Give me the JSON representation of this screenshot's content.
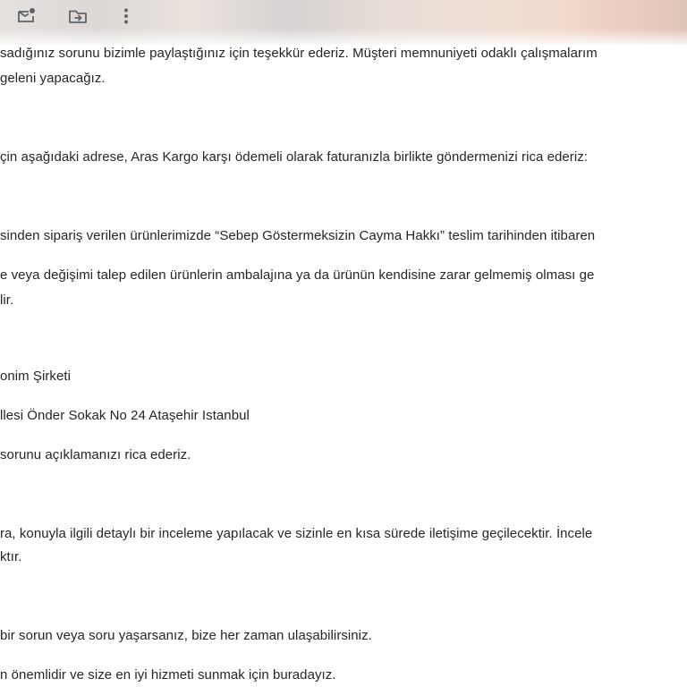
{
  "toolbar": {
    "icons": {
      "mark_unread": "mark-unread-icon",
      "move_to": "move-to-icon",
      "more": "more-vert-icon"
    }
  },
  "message": {
    "lines": [
      "sadığınız sorunu bizimle paylaştığınız için teşekkür ederiz. Müşteri memnuniyeti odaklı çalışmalarım",
      "geleni yapacağız.",
      "çin aşağıdaki adrese, Aras Kargo karşı ödemeli olarak faturanızla birlikte göndermenizi rica ederiz:",
      "sinden sipariş verilen ürünlerimizde “Sebep Göstermeksizin Cayma Hakkı” teslim tarihinden itibaren",
      "e veya değişimi talep edilen ürünlerin ambalajına ya da ürünün kendisine zarar gelmemiş olması ge",
      "lir.",
      "onim Şirketi",
      "llesi Önder Sokak No 24 Ataşehir Istanbul",
      "sorunu açıklamanızı rica ederiz.",
      "ra, konuyla ilgili detaylı bir inceleme yapılacak ve sizinle en kısa sürede iletişime geçilecektir. İncele",
      "ktır.",
      "bir sorun veya soru yaşarsanız, bize her zaman ulaşabilirsiniz.",
      "n önemlidir ve size en iyi hizmeti sunmak için buradayız."
    ]
  }
}
